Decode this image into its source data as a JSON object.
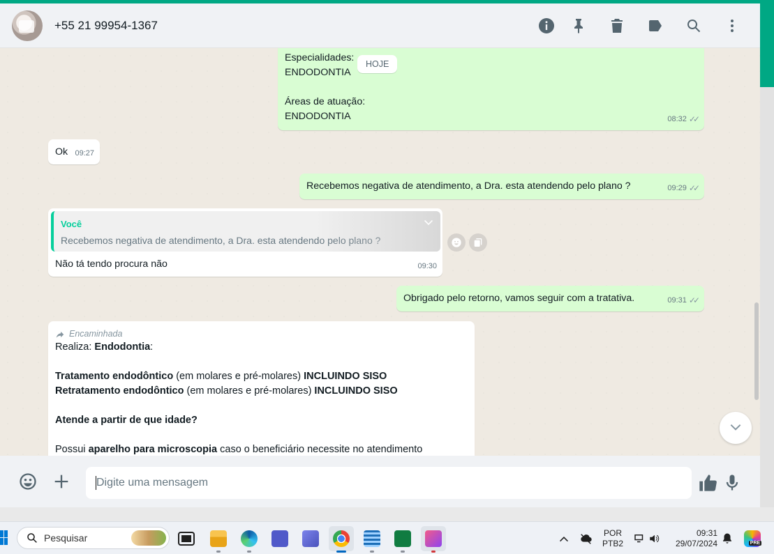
{
  "header": {
    "contact_name": "+55 21 99954-1367",
    "icons": [
      "info-icon",
      "pin-icon",
      "delete-icon",
      "label-icon",
      "search-icon",
      "menu-icon"
    ]
  },
  "chat": {
    "day_label": "HOJE",
    "msg1": {
      "line1": "Especialidades:",
      "line2": "ENDODONTIA",
      "line3": "Áreas de atuação:",
      "line4": "ENDODONTIA",
      "time": "08:32"
    },
    "msg2": {
      "text": "Ok",
      "time": "09:27"
    },
    "msg3": {
      "text": "Recebemos negativa de atendimento, a Dra. esta atendendo pelo plano ?",
      "time": "09:29"
    },
    "msg4": {
      "quote_author": "Você",
      "quote_text": "Recebemos negativa de atendimento, a Dra. esta atendendo pelo plano ?",
      "text": "Não tá tendo procura não",
      "time": "09:30"
    },
    "msg5": {
      "text": "Obrigado pelo retorno, vamos seguir com a tratativa.",
      "time": "09:31"
    },
    "msg6": {
      "forwarded_label": "Encaminhada",
      "l1a": "Realiza: ",
      "l1b": "Endodontia",
      "l1c": ":",
      "l2a": "Tratamento endodôntico",
      "l2b": " (em molares e pré-molares) ",
      "l2c": "INCLUINDO SISO",
      "l3a": "Retratamento endodôntico",
      "l3b": " (em molares e pré-molares) ",
      "l3c": "INCLUINDO SISO",
      "l4": "Atende a partir de que idade?",
      "l5a": "Possui ",
      "l5b": "aparelho para microscopia",
      "l5c": " caso o beneficiário necessite no atendimento"
    }
  },
  "composer": {
    "placeholder": "Digite uma mensagem"
  },
  "taskbar": {
    "search_label": "Pesquisar",
    "lang_top": "POR",
    "lang_bottom": "PTB2",
    "time": "09:31",
    "date": "29/07/2024",
    "copilot_badge": "PRE"
  },
  "colors": {
    "accent": "#00a884",
    "outgoing_bubble": "#d9fdd3",
    "incoming_bubble": "#ffffff",
    "chat_bg": "#efeae2"
  }
}
